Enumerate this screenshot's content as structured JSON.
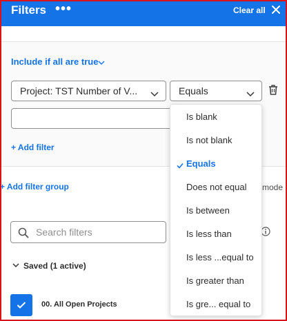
{
  "header": {
    "title": "Filters",
    "more": "•••",
    "clear_all": "Clear all"
  },
  "group": {
    "include_label": "Include if all are true",
    "field_value": "Project: TST Number of V...",
    "operator_value": "Equals",
    "value_input": "",
    "add_filter": "+ Add filter"
  },
  "add_filter_group": "+ Add filter group",
  "mode_text": "mode",
  "search": {
    "placeholder": "Search filters"
  },
  "saved": {
    "heading": "Saved (1 active)",
    "items": [
      {
        "name": "00. All Open Projects",
        "checked": true
      }
    ]
  },
  "operator_menu": {
    "selected": "Equals",
    "options": [
      "Is blank",
      "Is not blank",
      "Equals",
      "Does not equal",
      "Is between",
      "Is less than",
      "Is less ...equal to",
      "Is greater than",
      "Is gre...  equal to"
    ]
  },
  "colors": {
    "accent": "#1473e6",
    "frame": "#d8131b"
  }
}
